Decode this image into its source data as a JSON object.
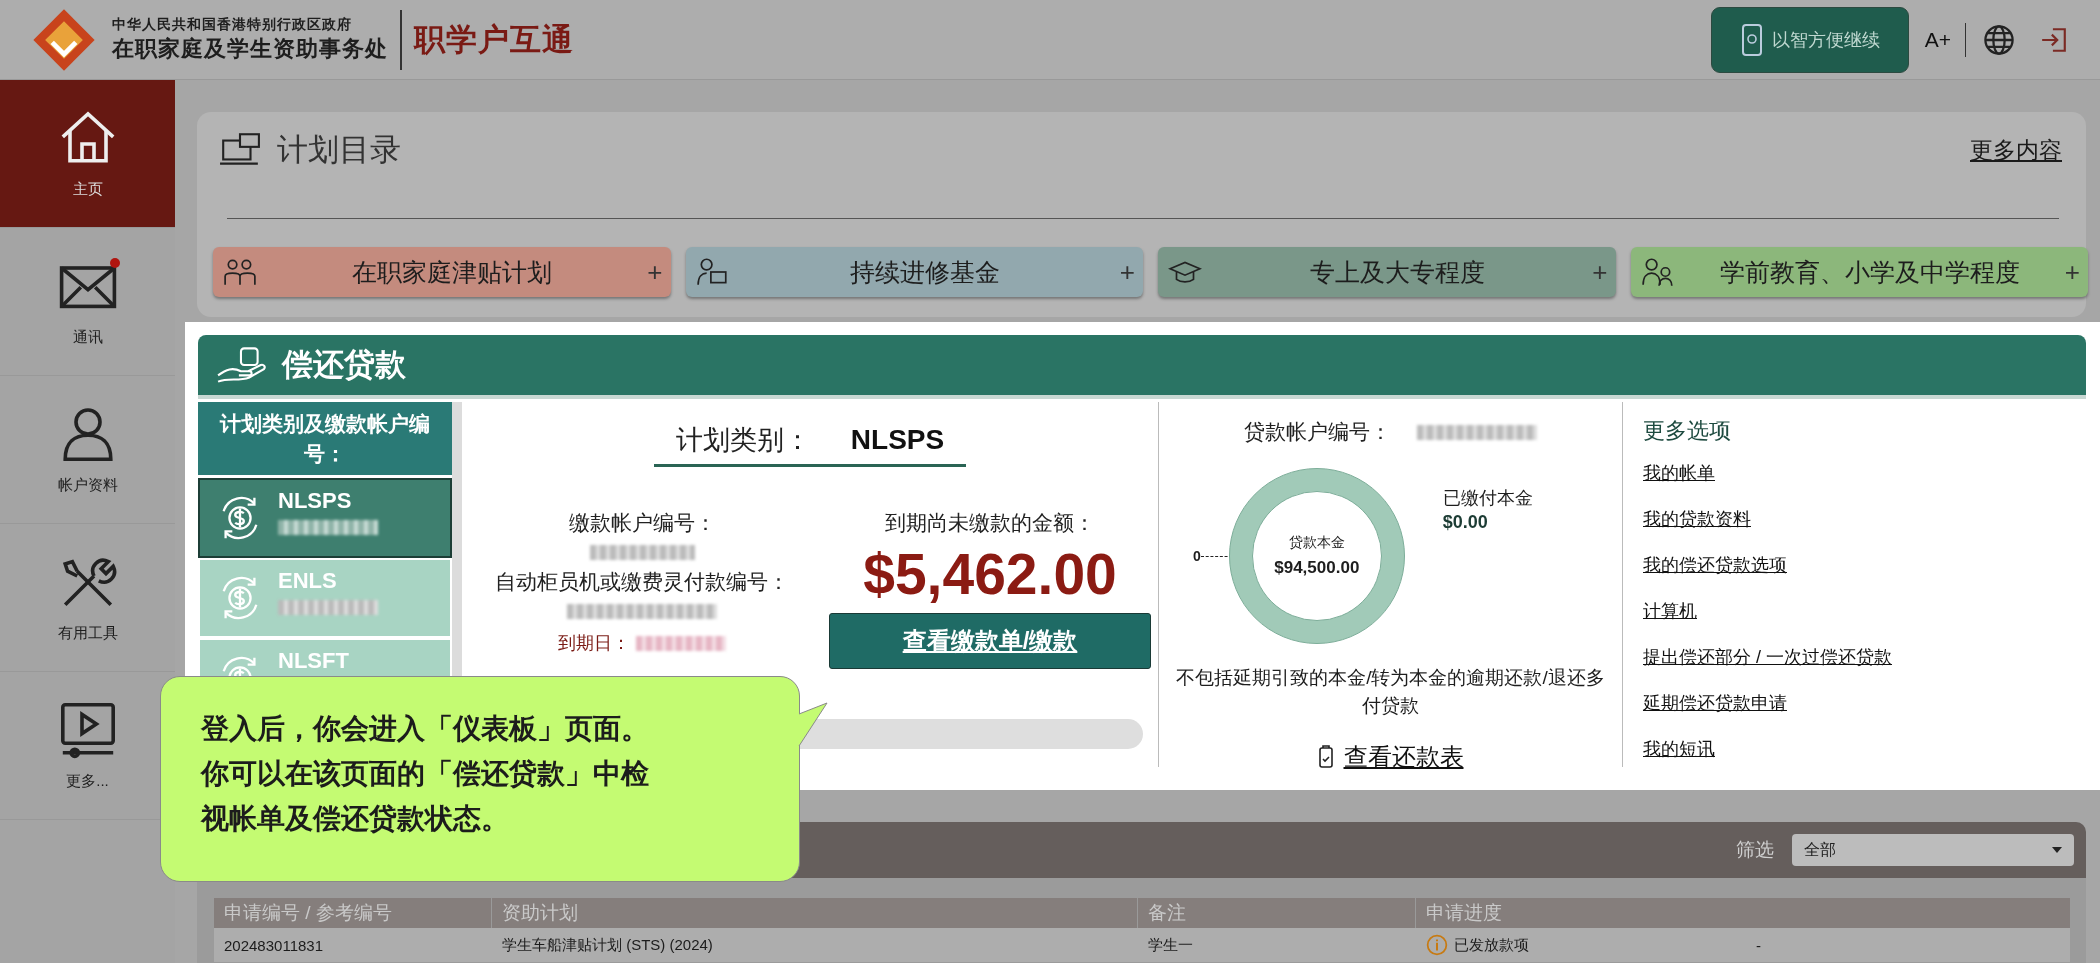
{
  "header": {
    "org_line_1": "中华人民共和国香港特别行政区政府",
    "org_line_2": "在职家庭及学生资助事务处",
    "app_title": "职学户互通",
    "continue_button": "以智方便继续",
    "font_size_button": "A+"
  },
  "sidebar": {
    "items": [
      {
        "label": "主页",
        "kind": "home",
        "selected": true,
        "badge": false
      },
      {
        "label": "通讯",
        "kind": "mail",
        "selected": false,
        "badge": true
      },
      {
        "label": "帐户资料",
        "kind": "account",
        "selected": false,
        "badge": false
      },
      {
        "label": "有用工具",
        "kind": "tools",
        "selected": false,
        "badge": false
      },
      {
        "label": "更多...",
        "kind": "video",
        "selected": false,
        "badge": false
      }
    ]
  },
  "plan_catalog": {
    "title": "计划目录",
    "more_link": "更多内容",
    "plans": [
      {
        "label": "在职家庭津贴计划",
        "kind": "family",
        "color": "#c48b7e",
        "toggle": "+"
      },
      {
        "label": "持续进修基金",
        "kind": "study",
        "color": "#92a8ae",
        "toggle": "+"
      },
      {
        "label": "专上及大专程度",
        "kind": "graduate",
        "color": "#7a9789",
        "toggle": "+"
      },
      {
        "label": "学前教育、小学及中学程度",
        "kind": "students",
        "color": "#8cb77b",
        "toggle": "+"
      }
    ]
  },
  "repayment": {
    "title": "偿还贷款",
    "list_header": "计划类别及缴款帐户编号：",
    "schemes": [
      {
        "code": "NLSPS",
        "selected": true
      },
      {
        "code": "ENLS",
        "selected": false
      },
      {
        "code": "NLSFT",
        "selected": false
      }
    ],
    "scheme_label": "计划类别：",
    "scheme_value": "NLSPS",
    "payment_account_label": "缴款帐户编号：",
    "atm_label": "自动柜员机或缴费灵付款编号：",
    "due_date_label": "到期日：",
    "outstanding_label": "到期尚未缴款的金额：",
    "outstanding_amount": "$5,462.00",
    "view_bill_button": "查看缴款单/缴款",
    "loan_account_label": "贷款帐户编号：",
    "donut": {
      "center_label": "贷款本金",
      "center_value": "$94,500.00",
      "zero_label": "0",
      "paid_label": "已缴付本金",
      "paid_value": "$0.00"
    },
    "note": "不包括延期引致的本金/转为本金的逾期还款/退还多付贷款",
    "schedule_link": "查看还款表",
    "more_options": {
      "title": "更多选项",
      "links": [
        "我的帐单",
        "我的贷款资料",
        "我的偿还贷款选项",
        "计算机",
        "提出偿还部分 / 一次过偿还贷款",
        "延期偿还贷款申请",
        "我的短讯"
      ]
    }
  },
  "applications": {
    "filter_label": "筛选",
    "filter_value": "全部",
    "columns": [
      "申请编号 / 参考编号",
      "资助计划",
      "备注",
      "申请进度"
    ],
    "rows": [
      {
        "ref": "202483011831",
        "scheme": "学生车船津贴计划 (STS) (2024)",
        "remark": "学生一",
        "status": "已发放款项",
        "column_5": "-"
      }
    ]
  },
  "callout": {
    "text": "登入后，你会进入「仪表板」页面。你可以在该页面的「偿还贷款」中检视帐单及偿还贷款状态。"
  }
}
